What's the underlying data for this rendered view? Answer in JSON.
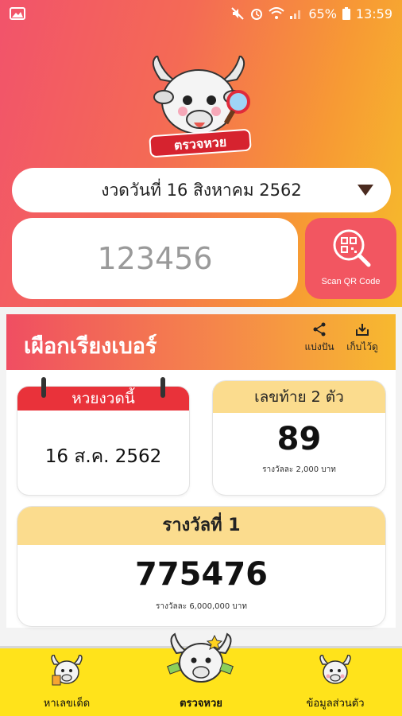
{
  "status_bar": {
    "battery": "65%",
    "time": "13:59"
  },
  "header": {
    "logo_text": "ตรวจหวย"
  },
  "draw_select": {
    "value": "งวดวันที่ 16 สิงหาคม 2562"
  },
  "number_input": {
    "placeholder": "123456"
  },
  "scan_button": {
    "label": "Scan QR Code"
  },
  "result_bar": {
    "title": "เผือกเรียงเบอร์",
    "share_label": "แบ่งปัน",
    "save_label": "เก็บไว้ดู"
  },
  "draw_card": {
    "header": "หวยงวดนี้",
    "date": "16 ส.ค. 2562"
  },
  "last_two_card": {
    "header": "เลขท้าย 2 ตัว",
    "number": "89",
    "prize": "รางวัลละ 2,000 บาท"
  },
  "first_prize_card": {
    "header": "รางวัลที่ 1",
    "number": "775476",
    "prize": "รางวัลละ 6,000,000 บาท"
  },
  "bottom_nav": {
    "items": [
      {
        "label": "หาเลขเด็ด"
      },
      {
        "label": "ตรวจหวย"
      },
      {
        "label": "ข้อมูลส่วนตัว"
      }
    ]
  },
  "colors": {
    "accent_red": "#f25661",
    "accent_yellow": "#ffe31b",
    "card_header": "#fbdc8e"
  }
}
